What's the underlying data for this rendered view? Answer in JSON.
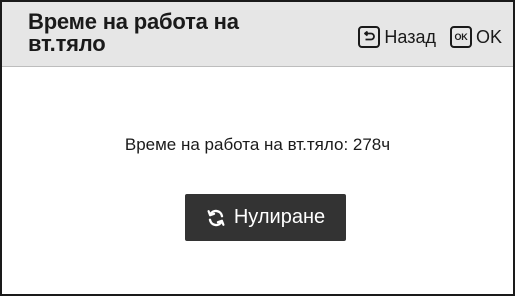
{
  "header": {
    "title": "Време на работа на вт.тяло",
    "back_label": "Назад",
    "back_icon": "back-arrow-icon",
    "ok_key_text": "OK",
    "ok_label": "OK"
  },
  "main": {
    "info_text": "Време на работа на вт.тяло: 278ч",
    "reset_label": "Нулиране",
    "reset_icon": "refresh-icon"
  },
  "colors": {
    "header_bg": "#e6e6e6",
    "button_bg": "#333333",
    "text": "#1a1a1a"
  }
}
